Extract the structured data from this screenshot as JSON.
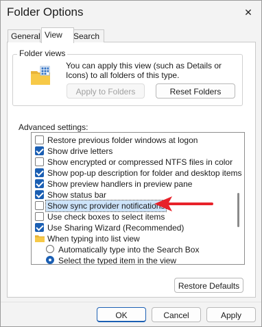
{
  "window": {
    "title": "Folder Options"
  },
  "tabs": [
    {
      "label": "General",
      "active": false
    },
    {
      "label": "View",
      "active": true
    },
    {
      "label": "Search",
      "active": false
    }
  ],
  "folder_views": {
    "title": "Folder views",
    "description": "You can apply this view (such as Details or Icons) to all folders of this type.",
    "apply_label": "Apply to Folders",
    "reset_label": "Reset Folders"
  },
  "advanced": {
    "label": "Advanced settings:",
    "items": [
      {
        "label": "Restore previous folder windows at logon",
        "type": "checkbox",
        "checked": false
      },
      {
        "label": "Show drive letters",
        "type": "checkbox",
        "checked": true
      },
      {
        "label": "Show encrypted or compressed NTFS files in color",
        "type": "checkbox",
        "checked": false
      },
      {
        "label": "Show pop-up description for folder and desktop items",
        "type": "checkbox",
        "checked": true
      },
      {
        "label": "Show preview handlers in preview pane",
        "type": "checkbox",
        "checked": true
      },
      {
        "label": "Show status bar",
        "type": "checkbox",
        "checked": true
      },
      {
        "label": "Show sync provider notifications",
        "type": "checkbox",
        "checked": false,
        "selected": true
      },
      {
        "label": "Use check boxes to select items",
        "type": "checkbox",
        "checked": false
      },
      {
        "label": "Use Sharing Wizard (Recommended)",
        "type": "checkbox",
        "checked": true
      },
      {
        "label": "When typing into list view",
        "type": "folder"
      },
      {
        "label": "Automatically type into the Search Box",
        "type": "radio",
        "checked": false
      },
      {
        "label": "Select the typed item in the view",
        "type": "radio",
        "checked": true
      }
    ]
  },
  "buttons": {
    "restore_defaults": "Restore Defaults",
    "ok": "OK",
    "cancel": "Cancel",
    "apply": "Apply"
  },
  "colors": {
    "accent": "#1b5fb3",
    "annotation_arrow": "#e8222a",
    "selection_highlight": "#cde4fb"
  },
  "icons": {
    "close": "close-icon",
    "folder_large": "folder-icon",
    "folder_small": "folder-icon",
    "arrow": "annotation-arrow-icon"
  }
}
